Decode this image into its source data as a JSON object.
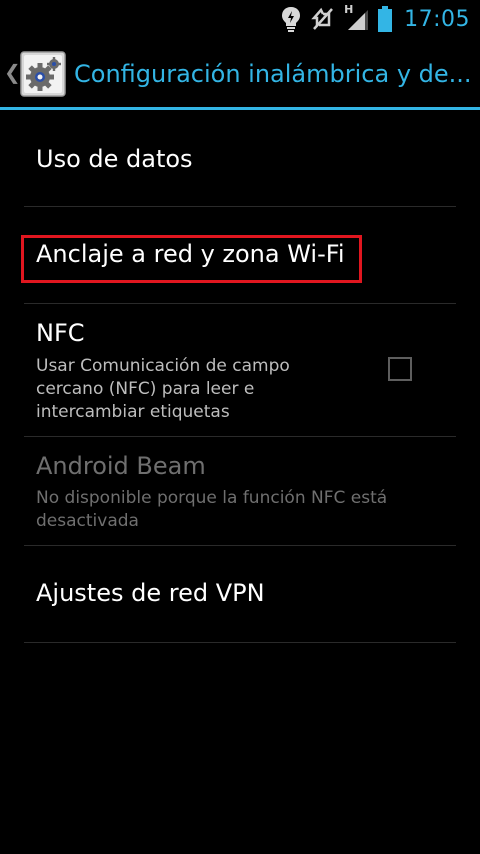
{
  "status_bar": {
    "time": "17:05",
    "network_type": "H",
    "icons": [
      "bulb-notification-icon",
      "vibrate-silent-icon",
      "signal-icon",
      "battery-icon"
    ],
    "accent_color": "#33b5e5"
  },
  "action_bar": {
    "title": "Configuración inalámbrica y de...",
    "up_icon": "chevron-left-icon",
    "app_icon": "settings-gear-icon"
  },
  "preferences": [
    {
      "title": "Uso de datos"
    },
    {
      "title": "Anclaje a red y zona Wi-Fi",
      "highlighted": true,
      "highlight_color": "#e0161f"
    },
    {
      "title": "NFC",
      "summary": "Usar Comunicación de campo cercano (NFC) para leer e intercambiar etiquetas",
      "checked": false
    },
    {
      "title": "Android Beam",
      "summary": "No disponible porque la función NFC está desactivada",
      "enabled": false
    },
    {
      "title": "Ajustes de red VPN"
    }
  ]
}
